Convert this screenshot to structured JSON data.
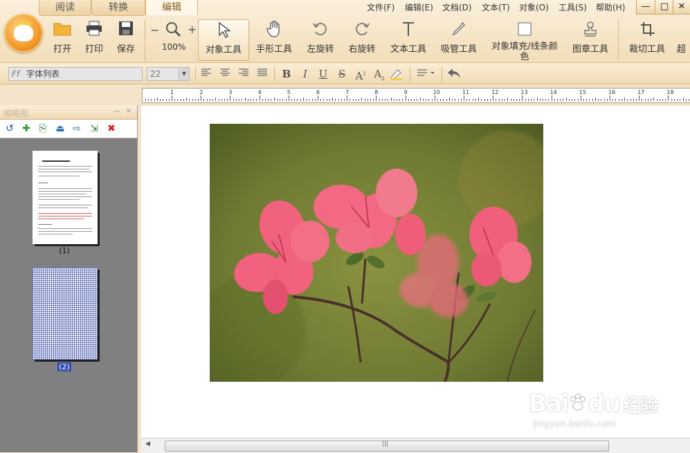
{
  "tabs": [
    {
      "label": "阅读",
      "active": false
    },
    {
      "label": "转换",
      "active": false
    },
    {
      "label": "编辑",
      "active": true
    }
  ],
  "menu": [
    "文件(F)",
    "编辑(E)",
    "文档(D)",
    "文本(T)",
    "对象(O)",
    "工具(S)",
    "帮助(H)"
  ],
  "window_buttons": [
    "—",
    "□",
    "✕"
  ],
  "toolbar": {
    "open": "打开",
    "print": "打印",
    "save": "保存",
    "zoom_out": "−",
    "zoom_in": "+",
    "zoom_level": "100%",
    "object_tool": "对象工具",
    "hand_tool": "手形工具",
    "rotate_left": "左旋转",
    "rotate_right": "右旋转",
    "text_tool": "文本工具",
    "eyedropper_tool": "吸管工具",
    "object_fill": "对象填充/线条颜色",
    "stamp_tool": "图章工具",
    "crop_tool": "裁切工具",
    "more": "超"
  },
  "format_bar": {
    "font_list": "字体列表",
    "font_size": "22",
    "bold": "B",
    "italic": "I",
    "underline": "U",
    "strike": "S",
    "superscript": "A",
    "subscript": "A"
  },
  "ruler_labels": [
    "1",
    "2",
    "3",
    "4",
    "5",
    "6",
    "7",
    "8",
    "9",
    "10",
    "11",
    "12",
    "13",
    "14",
    "15",
    "16",
    "17",
    "18"
  ],
  "thumbnail_panel": {
    "title": "缩略图",
    "pin": "ꟷ",
    "close": "✕",
    "pages": [
      {
        "label": "(1)",
        "type": "text"
      },
      {
        "label": "(2)",
        "type": "grid"
      }
    ]
  },
  "scrollbar": {
    "grip": "|||"
  },
  "watermark": {
    "brand": "Bai",
    "brand_tail": "du",
    "cn": "经验",
    "url": "jingyan.baidu.com"
  },
  "colors": {
    "accent": "#f39a2a",
    "panel_bg": "#808080",
    "toolbar_bg": "#f2ddb8",
    "petal": "#f1627e"
  }
}
